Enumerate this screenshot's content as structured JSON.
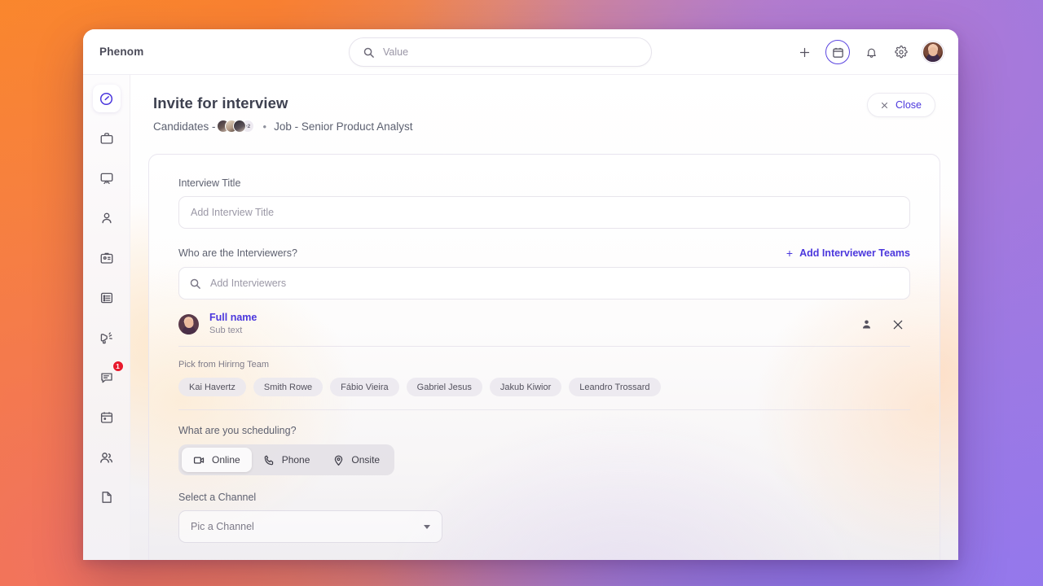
{
  "app": {
    "brand": "Phenom"
  },
  "topbar": {
    "search_placeholder": "Value",
    "icons": {
      "add": "plus-icon",
      "calendar": "calendar-icon",
      "notifications": "bell-icon",
      "settings": "gear-icon",
      "profile": "user-avatar"
    }
  },
  "sidebar": {
    "items": [
      {
        "name": "dashboard",
        "icon": "speedometer-icon",
        "active": true,
        "badge": ""
      },
      {
        "name": "jobs",
        "icon": "briefcase-icon",
        "active": false,
        "badge": ""
      },
      {
        "name": "screen",
        "icon": "monitor-icon",
        "active": false,
        "badge": ""
      },
      {
        "name": "candidates",
        "icon": "person-icon",
        "active": false,
        "badge": ""
      },
      {
        "name": "profiles",
        "icon": "id-badge-icon",
        "active": false,
        "badge": ""
      },
      {
        "name": "lists",
        "icon": "list-icon",
        "active": false,
        "badge": ""
      },
      {
        "name": "campaigns",
        "icon": "megaphone-icon",
        "active": false,
        "badge": ""
      },
      {
        "name": "messages",
        "icon": "chat-icon",
        "active": false,
        "badge": "1"
      },
      {
        "name": "calendar",
        "icon": "calendar-icon",
        "active": false,
        "badge": ""
      },
      {
        "name": "teams",
        "icon": "people-icon",
        "active": false,
        "badge": ""
      },
      {
        "name": "documents",
        "icon": "file-icon",
        "active": false,
        "badge": ""
      }
    ]
  },
  "page": {
    "title": "Invite for interview",
    "breadcrumb": {
      "candidates_label": "Candidates -",
      "avatar_more": "+2",
      "separator": "•",
      "job_label": "Job - Senior Product Analyst"
    },
    "close_button": {
      "label": "Close",
      "icon": "close-icon"
    }
  },
  "form": {
    "interview_title": {
      "label": "Interview Title",
      "placeholder": "Add Interview Title",
      "value": ""
    },
    "interviewers": {
      "label": "Who are the Interviewers?",
      "add_teams_label": "Add Interviewer Teams",
      "search_placeholder": "Add Interviewers",
      "value": ""
    },
    "selected_person": {
      "name": "Full name",
      "subtext": "Sub text",
      "action_profile_icon": "person-icon",
      "action_remove_icon": "close-icon"
    },
    "hiring_team": {
      "label": "Pick from Hirirng Team",
      "chips": [
        "Kai Havertz",
        "Smith Rowe",
        "Fábio Vieira",
        "Gabriel Jesus",
        "Jakub Kiwior",
        "Leandro Trossard"
      ]
    },
    "scheduling": {
      "label": "What are you scheduling?",
      "options": [
        {
          "label": "Online",
          "icon": "video-camera-icon",
          "selected": true
        },
        {
          "label": "Phone",
          "icon": "phone-icon",
          "selected": false
        },
        {
          "label": "Onsite",
          "icon": "map-pin-icon",
          "selected": false
        }
      ]
    },
    "channel": {
      "label": "Select a Channel",
      "placeholder": "Pic a Channel",
      "value": "",
      "caret_icon": "chevron-down-icon"
    }
  },
  "colors": {
    "accent": "#4b37dd",
    "badge_red": "#e8192c",
    "text_primary": "#3e4150",
    "text_muted": "#7d7a88",
    "bg_left": "#f9852c",
    "bg_right": "#8b7bee"
  }
}
